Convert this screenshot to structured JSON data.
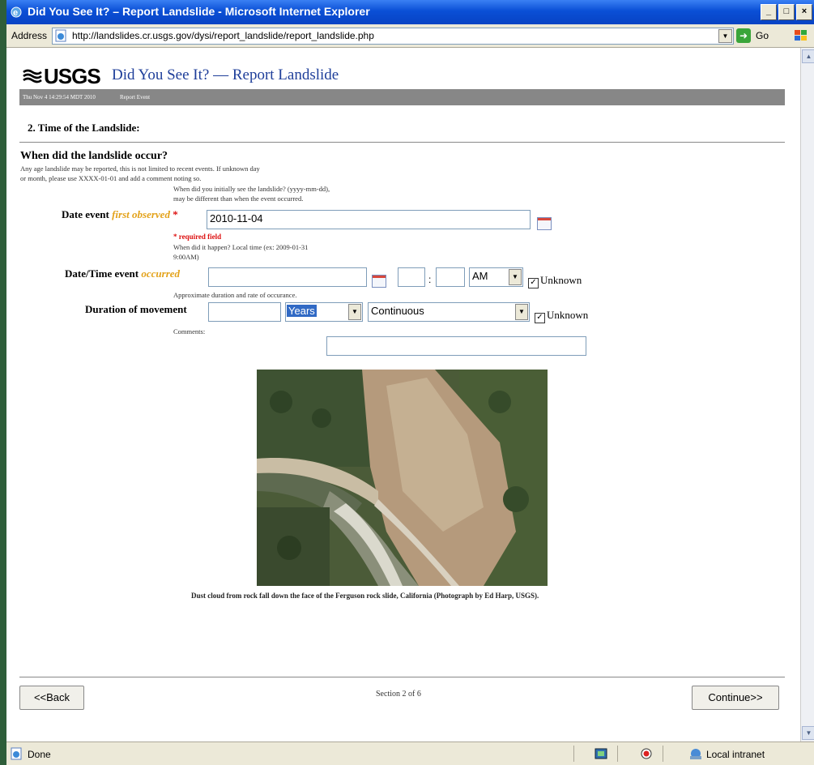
{
  "window": {
    "title": "Did You See It? – Report Landslide - Microsoft Internet Explorer",
    "controls": [
      "_",
      "□",
      "×"
    ]
  },
  "addressbar": {
    "label": "Address",
    "url": "http://landslides.cr.usgs.gov/dysi/report_landslide/report_landslide.php",
    "go_label": "Go"
  },
  "header": {
    "logo": "USGS",
    "page_title": "Did You See It? — Report Landslide",
    "timestamp": "Thu Nov 4 14:29:54 MDT 2010",
    "breadcrumb": "Report Event"
  },
  "section": {
    "heading": "2. Time of the Landslide:",
    "question": "When did the landslide occur?",
    "note_line1": "Any age landslide may be reported, this is not limited to recent events. If unknown day",
    "note_line2": "or month, please use XXXX-01-01 and add a comment noting so."
  },
  "first_observed": {
    "hint_line1": "When did you initially see the landslide? (yyyy-mm-dd),",
    "hint_line2": "may be different than when the event occurred.",
    "label_prefix": "Date event",
    "label_em": "first observed",
    "star": "*",
    "value": "2010-11-04",
    "required_note": "* required field"
  },
  "occurred": {
    "hint_line1": "When did it happen? Local time (ex: 2009-01-31",
    "hint_line2": "9:00AM)",
    "label_prefix": "Date/Time event",
    "label_em": "occurred",
    "date_value": "",
    "hour_value": "",
    "minute_value": "",
    "colon": ":",
    "ampm": "AM",
    "unknown_label": "Unknown",
    "unknown_checked": true
  },
  "duration": {
    "hint": "Approximate duration and rate of occurance.",
    "label": "Duration of movement",
    "value": "",
    "unit": "Years",
    "rate": "Continuous",
    "unknown_label": "Unknown",
    "unknown_checked": true
  },
  "comments": {
    "label": "Comments:",
    "value": ""
  },
  "photo": {
    "caption": "Dust cloud from rock fall down the face of the Ferguson rock slide, California (Photograph by Ed Harp, USGS)."
  },
  "nav": {
    "back_label": "<<Back",
    "section_count": "Section 2 of 6",
    "continue_label": "Continue>>"
  },
  "statusbar": {
    "status": "Done",
    "zone": "Local intranet"
  }
}
